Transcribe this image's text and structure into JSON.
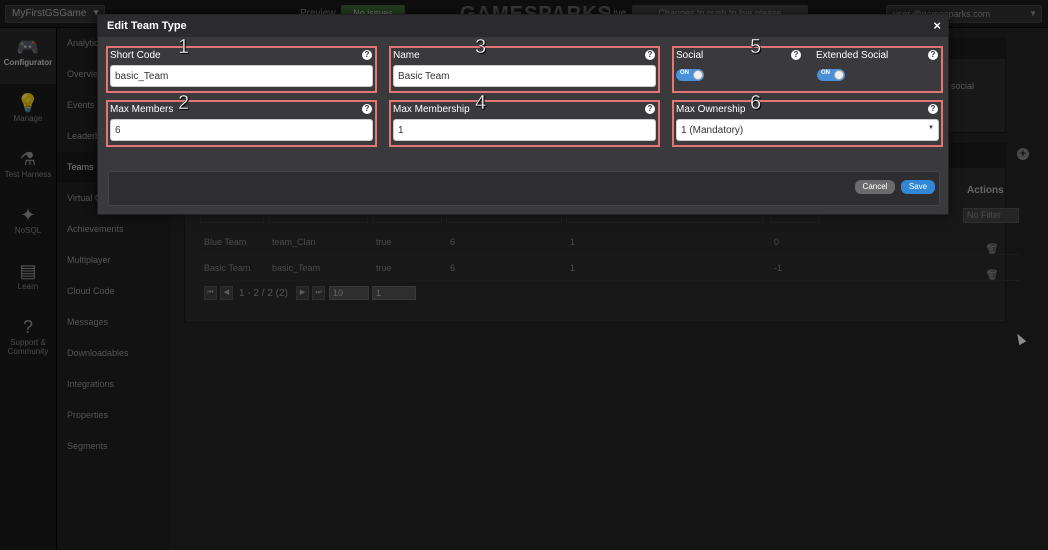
{
  "topbar": {
    "game_select": "MyFirstGSGame",
    "preview_label": "Preview",
    "preview_btn": "No issues",
    "logo": "GAMESPARKS",
    "live_label": "Live",
    "live_btn": "Changes to push to live please",
    "user": "user.@gamesparks.com"
  },
  "leftnav": [
    {
      "label": "Configurator",
      "icon": "gamepad-icon"
    },
    {
      "label": "Manage",
      "icon": "lightbulb-icon"
    },
    {
      "label": "Test Harness",
      "icon": "flask-icon"
    },
    {
      "label": "NoSQL",
      "icon": "wand-icon"
    },
    {
      "label": "Learn",
      "icon": "book-icon"
    },
    {
      "label": "Support & Community",
      "icon": "question-icon"
    }
  ],
  "sidebar": [
    "Analytics",
    "Overview",
    "Events",
    "Leaderboards",
    "Teams",
    "Virtual Goods",
    "Achievements",
    "Multiplayer",
    "Cloud Code",
    "Messages",
    "Downloadables",
    "Integrations",
    "Properties",
    "Segments"
  ],
  "background": {
    "social_text": "social",
    "actions_header": "Actions",
    "no_filter": "No Filter",
    "rows": [
      {
        "name": "Blue Team",
        "code": "team_Clan",
        "social": "true",
        "max_members": "6",
        "max_membership": "1",
        "ownership": "0"
      },
      {
        "name": "Basic Team",
        "code": "basic_Team",
        "social": "true",
        "max_members": "6",
        "max_membership": "1",
        "ownership": "-1"
      }
    ],
    "pagination": "1 - 2 / 2 (2)",
    "page_size": "10",
    "page_num": "1"
  },
  "modal": {
    "title": "Edit Team Type",
    "close": "×",
    "fields": {
      "short_code": {
        "label": "Short Code",
        "value": "basic_Team",
        "tag": "1"
      },
      "max_members": {
        "label": "Max Members",
        "value": "6",
        "tag": "2"
      },
      "name": {
        "label": "Name",
        "value": "Basic Team",
        "tag": "3"
      },
      "max_membership": {
        "label": "Max Membership",
        "value": "1",
        "tag": "4"
      },
      "social": {
        "label": "Social",
        "extended_label": "Extended Social",
        "toggle": "ON",
        "extended_toggle": "ON",
        "tag": "5"
      },
      "max_ownership": {
        "label": "Max Ownership",
        "value": "1 (Mandatory)",
        "tag": "6"
      }
    },
    "help": "?",
    "cancel": "Cancel",
    "save": "Save"
  }
}
